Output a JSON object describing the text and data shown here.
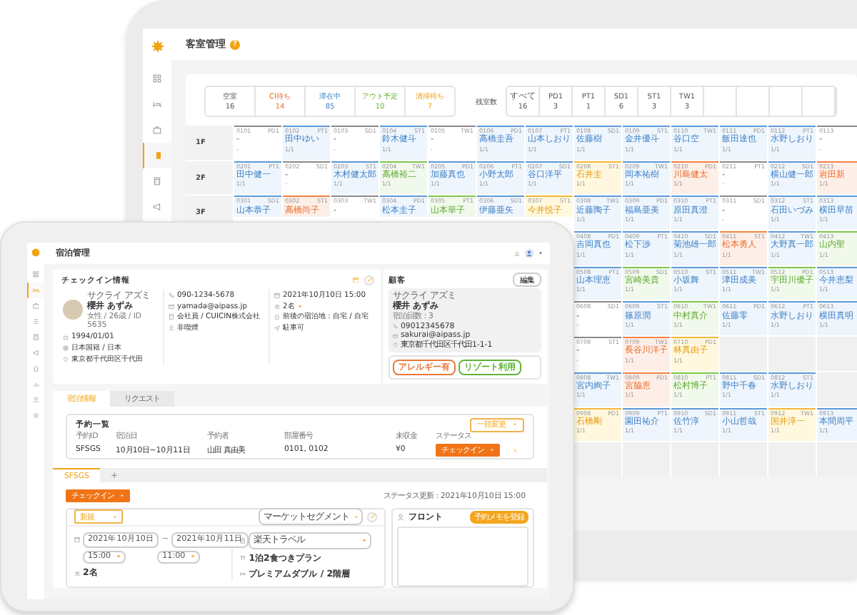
{
  "back_window": {
    "title": "客室管理",
    "help_badge": "?",
    "sidebar": [
      {
        "kind": "dashboard",
        "selected": false
      },
      {
        "kind": "bed",
        "selected": false
      },
      {
        "kind": "suitcase",
        "selected": false
      },
      {
        "kind": "room",
        "selected": true
      },
      {
        "kind": "calculator",
        "selected": false
      },
      {
        "kind": "megaphone",
        "selected": false
      }
    ],
    "status_counts": [
      {
        "label": "空室",
        "count": "16",
        "kind": "vacant"
      },
      {
        "label": "CI待ち",
        "count": "14",
        "kind": "ci_wait"
      },
      {
        "label": "滞在中",
        "count": "85",
        "kind": "staying"
      },
      {
        "label": "アウト予定",
        "count": "10",
        "kind": "out_planned"
      },
      {
        "label": "清掃待ち",
        "count": "7",
        "kind": "cleaning"
      }
    ],
    "remaining_label": "残室数",
    "room_types": [
      {
        "label": "すべて",
        "count": "16"
      },
      {
        "label": "PD1",
        "count": "3"
      },
      {
        "label": "PT1",
        "count": "1"
      },
      {
        "label": "SD1",
        "count": "6"
      },
      {
        "label": "ST1",
        "count": "3"
      },
      {
        "label": "TW1",
        "count": "3"
      }
    ],
    "floors": [
      {
        "label": "1F",
        "rooms": [
          {
            "number": "0101",
            "type": "PD1",
            "guest": "-",
            "nights": "-",
            "kind": "vacant"
          },
          {
            "number": "0102",
            "type": "PT1",
            "guest": "田中ゆい",
            "nights": "1/1",
            "kind": "staying"
          },
          {
            "number": "0103",
            "type": "SD1",
            "guest": "-",
            "nights": "-",
            "kind": "vacant"
          },
          {
            "number": "0104",
            "type": "ST1",
            "guest": "鈴木健斗",
            "nights": "1/1",
            "kind": "staying"
          },
          {
            "number": "0105",
            "type": "TW1",
            "guest": "-",
            "nights": "-",
            "kind": "vacant"
          },
          {
            "number": "0106",
            "type": "PD1",
            "guest": "高橋圭吾",
            "nights": "1/1",
            "kind": "staying"
          },
          {
            "number": "0107",
            "type": "PT1",
            "guest": "山本しおり",
            "nights": "1/1",
            "kind": "staying"
          },
          {
            "number": "0108",
            "type": "SD1",
            "guest": "佐藤樹",
            "nights": "1/1",
            "kind": "staying"
          },
          {
            "number": "0109",
            "type": "ST1",
            "guest": "金井優斗",
            "nights": "1/1",
            "kind": "staying"
          },
          {
            "number": "0110",
            "type": "TW1",
            "guest": "谷口空",
            "nights": "1/1",
            "kind": "staying"
          },
          {
            "number": "0111",
            "type": "PD1",
            "guest": "飯田達也",
            "nights": "1/1",
            "kind": "staying"
          },
          {
            "number": "0112",
            "type": "PT1",
            "guest": "水野しおり",
            "nights": "1/1",
            "kind": "staying"
          },
          {
            "number": "0113",
            "guest": "-",
            "nights": "-",
            "kind": "vacant"
          }
        ]
      },
      {
        "label": "2F",
        "rooms": [
          {
            "number": "0201",
            "type": "PT1",
            "guest": "田中健一",
            "nights": "1/1",
            "kind": "staying"
          },
          {
            "number": "0202",
            "type": "SD1",
            "guest": "-",
            "nights": "-",
            "kind": "vacant"
          },
          {
            "number": "0203",
            "type": "ST1",
            "guest": "木村健太郎",
            "nights": "1/1",
            "kind": "staying"
          },
          {
            "number": "0204",
            "type": "TW1",
            "guest": "高橋裕二",
            "nights": "1/1",
            "kind": "out_planned"
          },
          {
            "number": "0205",
            "type": "PD1",
            "guest": "加藤真也",
            "nights": "1/1",
            "kind": "staying"
          },
          {
            "number": "0206",
            "type": "PT1",
            "guest": "小野太郎",
            "nights": "1/1",
            "kind": "staying"
          },
          {
            "number": "0207",
            "type": "SD1",
            "guest": "谷口洋平",
            "nights": "1/1",
            "kind": "staying"
          },
          {
            "number": "0208",
            "type": "ST1",
            "guest": "石井圭",
            "nights": "1/1",
            "kind": "cleaning"
          },
          {
            "number": "0209",
            "type": "TW1",
            "guest": "岡本祐樹",
            "nights": "1/1",
            "kind": "staying"
          },
          {
            "number": "0210",
            "type": "PD1",
            "guest": "川島健太",
            "nights": "1/1",
            "kind": "ci_wait"
          },
          {
            "number": "0211",
            "type": "PT1",
            "guest": "-",
            "nights": "-",
            "kind": "vacant"
          },
          {
            "number": "0212",
            "type": "SD1",
            "guest": "横山健一郎",
            "nights": "1/1",
            "kind": "staying"
          },
          {
            "number": "0213",
            "guest": "岩田新",
            "nights": "1/1",
            "kind": "ci_wait"
          }
        ]
      },
      {
        "label": "3F",
        "rooms": [
          {
            "number": "0301",
            "type": "SD1",
            "guest": "山本恭子",
            "kind": "staying"
          },
          {
            "number": "0302",
            "type": "ST1",
            "guest": "高橋尚子",
            "kind": "ci_wait"
          },
          {
            "number": "0303",
            "type": "TW1",
            "guest": "-",
            "kind": "vacant"
          },
          {
            "number": "0304",
            "type": "PD1",
            "guest": "松本圭子",
            "kind": "staying"
          },
          {
            "number": "0305",
            "type": "PT1",
            "guest": "山本華子",
            "kind": "out_planned"
          },
          {
            "number": "0306",
            "type": "SD1",
            "guest": "伊藤亜矢",
            "kind": "staying"
          },
          {
            "number": "0307",
            "type": "ST1",
            "guest": "今井悦子",
            "kind": "cleaning"
          },
          {
            "number": "0308",
            "type": "TW1",
            "guest": "近藤陶子",
            "nights": "1/1",
            "kind": "staying"
          },
          {
            "number": "0309",
            "type": "PD1",
            "guest": "福島亜美",
            "nights": "1/1",
            "kind": "staying"
          },
          {
            "number": "0310",
            "type": "PT1",
            "guest": "原田真澄",
            "nights": "1/1",
            "kind": "staying"
          },
          {
            "number": "0311",
            "type": "SD1",
            "guest": "-",
            "nights": "-",
            "kind": "vacant"
          },
          {
            "number": "0312",
            "type": "ST1",
            "guest": "石田いづみ",
            "nights": "1/1",
            "kind": "staying"
          },
          {
            "number": "0313",
            "guest": "横田早苗",
            "nights": "1/1",
            "kind": "staying"
          }
        ]
      },
      {
        "rooms": [
          {
            "number": "0408",
            "type": "PD1",
            "guest": "吉岡真也",
            "nights": "1/1",
            "kind": "staying"
          },
          {
            "number": "0409",
            "type": "PT1",
            "guest": "松下渉",
            "nights": "1/1",
            "kind": "staying"
          },
          {
            "number": "0410",
            "type": "SD1",
            "guest": "菊池雄一郎",
            "nights": "1/1",
            "kind": "staying"
          },
          {
            "number": "0411",
            "type": "ST1",
            "guest": "松本勇人",
            "nights": "1/1",
            "kind": "ci_wait"
          },
          {
            "number": "0412",
            "type": "TW1",
            "guest": "大野真一郎",
            "nights": "1/1",
            "kind": "staying"
          },
          {
            "number": "0413",
            "guest": "山内聖",
            "nights": "1/1",
            "kind": "out_planned"
          }
        ]
      },
      {
        "rooms": [
          {
            "number": "0508",
            "type": "PT1",
            "guest": "山本理恵",
            "nights": "1/1",
            "kind": "staying"
          },
          {
            "number": "0509",
            "type": "SD1",
            "guest": "宮崎美貴",
            "nights": "1/1",
            "kind": "out_planned"
          },
          {
            "number": "0510",
            "type": "ST1",
            "guest": "小坂舞",
            "nights": "1/1",
            "kind": "staying"
          },
          {
            "number": "0511",
            "type": "TW1",
            "guest": "津田成美",
            "nights": "1/1",
            "kind": "staying"
          },
          {
            "number": "0512",
            "type": "PD1",
            "guest": "宇田川優子",
            "nights": "1/1",
            "kind": "out_planned"
          },
          {
            "number": "0513",
            "guest": "今井恵梨",
            "nights": "1/1",
            "kind": "staying"
          }
        ]
      },
      {
        "rooms": [
          {
            "number": "0608",
            "type": "SD1",
            "guest": "-",
            "nights": "-",
            "kind": "vacant"
          },
          {
            "number": "0609",
            "type": "ST1",
            "guest": "篠原潤",
            "nights": "1/1",
            "kind": "staying"
          },
          {
            "number": "0610",
            "type": "TW1",
            "guest": "中村真介",
            "nights": "1/1",
            "kind": "out_planned"
          },
          {
            "number": "0611",
            "type": "PD1",
            "guest": "佐藤零",
            "nights": "1/1",
            "kind": "staying"
          },
          {
            "number": "0612",
            "type": "PT1",
            "guest": "水野しおり",
            "nights": "1/1",
            "kind": "staying"
          },
          {
            "number": "0613",
            "guest": "横田真明",
            "nights": "1/1",
            "kind": "staying"
          }
        ]
      },
      {
        "rooms": [
          {
            "number": "0708",
            "type": "ST1",
            "guest": "-",
            "nights": "-",
            "kind": "vacant"
          },
          {
            "number": "0709",
            "type": "TW1",
            "guest": "長谷川洋子",
            "nights": "1/1",
            "kind": "ci_wait"
          },
          {
            "number": "0710",
            "type": "PD1",
            "guest": "林真由子",
            "nights": "1/1",
            "kind": "cleaning"
          }
        ]
      },
      {
        "rooms": [
          {
            "number": "0808",
            "type": "TW1",
            "guest": "宮内絢子",
            "nights": "1/1",
            "kind": "staying"
          },
          {
            "number": "0809",
            "type": "PD1",
            "guest": "宮脇恵",
            "nights": "1/1",
            "kind": "ci_wait"
          },
          {
            "number": "0810",
            "type": "PT1",
            "guest": "松村博子",
            "nights": "1/1",
            "kind": "out_planned"
          },
          {
            "number": "0811",
            "type": "SD1",
            "guest": "野中千春",
            "nights": "1/1",
            "kind": "staying"
          },
          {
            "number": "0812",
            "type": "ST1",
            "guest": "水野しおり",
            "nights": "1/1",
            "kind": "staying"
          }
        ]
      },
      {
        "rooms": [
          {
            "number": "0908",
            "type": "PD1",
            "guest": "石橋剛",
            "nights": "1/1",
            "kind": "cleaning"
          },
          {
            "number": "0909",
            "type": "PT1",
            "guest": "園田祐介",
            "nights": "1/1",
            "kind": "staying"
          },
          {
            "number": "0910",
            "type": "SD1",
            "guest": "佐竹淳",
            "nights": "1/1",
            "kind": "staying"
          },
          {
            "number": "0911",
            "type": "ST1",
            "guest": "小山哲哉",
            "nights": "1/1",
            "kind": "staying"
          },
          {
            "number": "0912",
            "type": "TW1",
            "guest": "国井淳一",
            "nights": "1/1",
            "kind": "cleaning"
          },
          {
            "number": "0913",
            "guest": "本間周平",
            "nights": "1/1",
            "kind": "staying"
          }
        ]
      }
    ]
  },
  "front_window": {
    "title": "宿泊管理",
    "sidebar": [
      {
        "kind": "dashboard",
        "selected": false
      },
      {
        "kind": "bed",
        "selected": true
      },
      {
        "kind": "suitcase",
        "selected": false
      },
      {
        "kind": "list",
        "selected": false
      },
      {
        "kind": "calculator",
        "selected": false
      },
      {
        "kind": "megaphone",
        "selected": false
      },
      {
        "kind": "house",
        "selected": false
      },
      {
        "kind": "chart",
        "selected": false
      },
      {
        "kind": "person",
        "selected": false
      },
      {
        "kind": "settings",
        "selected": false
      }
    ],
    "checkin": {
      "title": "チェックイン情報",
      "kana": "サクライ アズミ",
      "name": "櫻井 あずみ",
      "meta": "女性 / 26歳 / ID 5635",
      "columns": [
        [
          {
            "kind": "cake",
            "text": "1994/01/01"
          },
          {
            "kind": "globe",
            "text": "日本国籍 / 日本"
          },
          {
            "kind": "pin",
            "text": "東京都千代田区千代田"
          }
        ],
        [
          {
            "kind": "phone",
            "text": "090-1234-5678"
          },
          {
            "kind": "mail",
            "text": "yamada@aipass.jp"
          },
          {
            "kind": "building",
            "text": "会社員 / CUICIN株式会社"
          },
          {
            "kind": "person",
            "text": "非喫煙"
          }
        ],
        [
          {
            "kind": "calendar",
            "text": "2021年10月10日 15:00"
          },
          {
            "kind": "people",
            "text": "2名",
            "dropdown": true
          },
          {
            "kind": "house",
            "text": "前後の宿泊地：自宅 / 自宅"
          },
          {
            "kind": "send",
            "text": "駐車可"
          }
        ]
      ]
    },
    "customer": {
      "title": "顧客",
      "edit_button": "編集",
      "kana": "サクライ アズミ",
      "name": "櫻井 あずみ",
      "stays": "宿泊回数：3",
      "contacts": [
        {
          "kind": "phone",
          "text": "09012345678"
        },
        {
          "kind": "mail",
          "text": "sakurai@aipass.jp"
        },
        {
          "kind": "pin",
          "text": "東京都千代田区千代田1-1-1"
        }
      ],
      "tags": [
        {
          "label": "アレルギー有",
          "color": "#e8793c"
        },
        {
          "label": "リゾート利用",
          "color": "#5fb33a"
        }
      ]
    },
    "tabs": [
      {
        "label": "宿泊情報",
        "selected": true
      },
      {
        "label": "リクエスト",
        "selected": false
      }
    ],
    "reservations": {
      "title": "予約一覧",
      "bulk_button": "一括変更",
      "columns": [
        "予約ID",
        "宿泊日",
        "予約者",
        "部屋番号",
        "未収金",
        "ステータス"
      ],
      "rows": [
        {
          "cells": [
            "SFSGS",
            "10月10日~10月11日",
            "山田 真由美",
            "0101, 0102",
            "¥0"
          ],
          "status": "チェックイン"
        }
      ]
    },
    "booking_tabs": [
      {
        "label": "SFSGS",
        "selected": true
      }
    ],
    "add_tab": "+",
    "status_button": "チェックイン",
    "status_updated": "ステータス更新：2021年10月10日 15:00",
    "detail": {
      "type_select": "新規",
      "segment_select": "マーケットセグメント",
      "checkin_date": "2021年10月10日",
      "separator": "~",
      "checkout_date": "2021年10月11日",
      "checkin_time": "15:00",
      "checkout_time": "11:00",
      "guests": "2名",
      "channel_select": "楽天トラベル",
      "plan": "1泊2食つきプラン",
      "room_type": "プレミアムダブル / 2階層"
    },
    "front_memo": {
      "title": "フロント",
      "button": "予約メモを登録"
    }
  }
}
